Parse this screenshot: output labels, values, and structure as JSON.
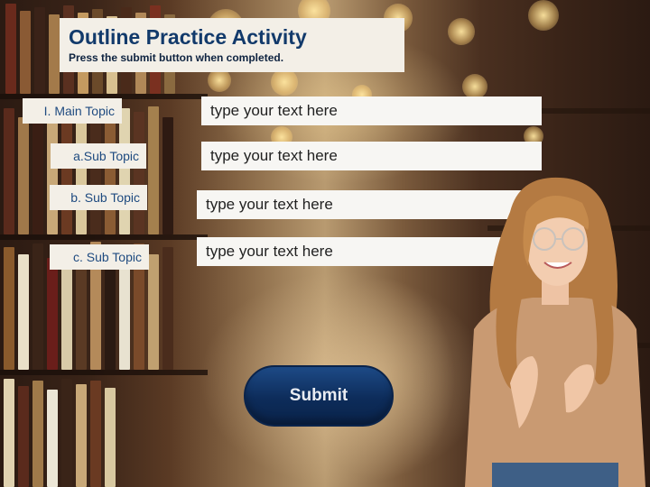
{
  "activity": {
    "title": "Outline Practice Activity",
    "instruction": "Press the submit button when completed."
  },
  "outline": {
    "main_topic": {
      "label": "I. Main Topic",
      "placeholder": "type your text here"
    },
    "sub_topic_a": {
      "label": "a.Sub Topic",
      "placeholder": "type your text here"
    },
    "sub_topic_b": {
      "label": "b. Sub Topic",
      "placeholder": "type your text here"
    },
    "sub_topic_c": {
      "label": "c. Sub Topic",
      "placeholder": "type your text here"
    }
  },
  "submit": {
    "label": "Submit"
  },
  "colors": {
    "title_text": "#123a6b",
    "label_text": "#1f4b80",
    "card_background": "#f3efe7",
    "button_background": "#0d2c5a"
  }
}
